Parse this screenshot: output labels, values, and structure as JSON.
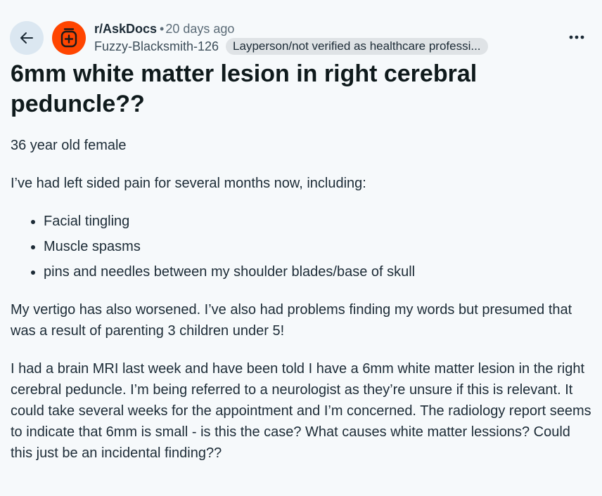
{
  "post": {
    "subreddit": "r/AskDocs",
    "separator": "•",
    "timestamp": "20 days ago",
    "username": "Fuzzy-Blacksmith-126",
    "flair": "Layperson/not verified as healthcare professi...",
    "title": "6mm white matter lesion in right cerebral peduncle??",
    "paragraphs": [
      "36 year old female",
      "I’ve had left sided pain for several months now, including:"
    ],
    "bullets": [
      "Facial tingling",
      "Muscle spasms",
      "pins and needles between my shoulder blades/base of skull"
    ],
    "paragraphs_after": [
      "My vertigo has also worsened. I’ve also had problems finding my words but presumed that was a result of parenting 3 children under 5!",
      "I had a brain MRI last week and have been told I have a 6mm white matter lesion in the right cerebral peduncle. I’m being referred to a neurologist as they’re unsure if this is relevant. It could take several weeks for the appointment and I’m concerned. The radiology report seems to indicate that 6mm is small - is this the case? What causes white matter lessions? Could this just be an incidental finding??"
    ]
  },
  "icons": {
    "back": "arrow-left-icon",
    "avatar": "medical-kit-icon",
    "more": "more-horizontal-icon"
  },
  "colors": {
    "avatar_bg": "#ff4500",
    "back_bg": "#dbe7f1",
    "flair_bg": "#dfe3e6",
    "page_bg": "#f6f9fb",
    "text": "#1c2b36"
  }
}
